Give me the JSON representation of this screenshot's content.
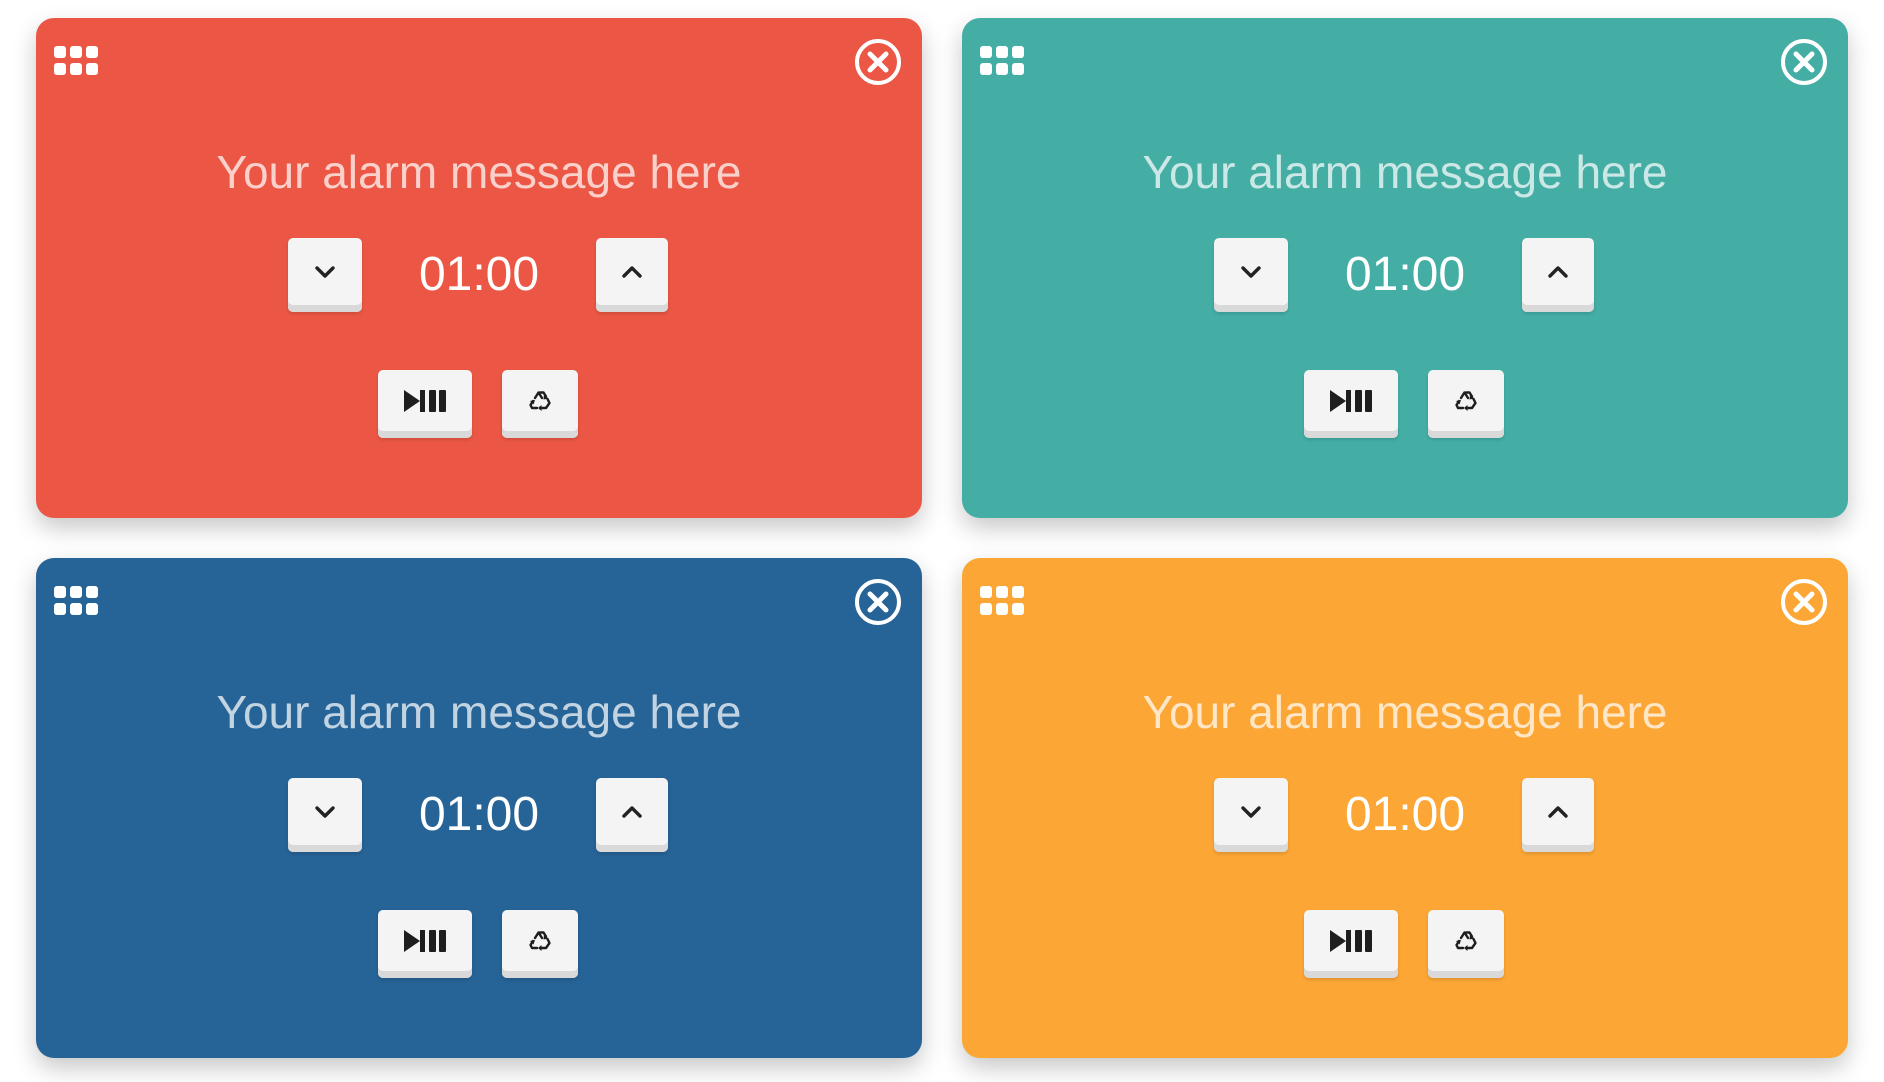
{
  "alarms": [
    {
      "message": "Your alarm message here",
      "time": "01:00",
      "color": "#eb5744"
    },
    {
      "message": "Your alarm message here",
      "time": "01:00",
      "color": "#44aea5"
    },
    {
      "message": "Your alarm message here",
      "time": "01:00",
      "color": "#266396"
    },
    {
      "message": "Your alarm message here",
      "time": "01:00",
      "color": "#fba635"
    }
  ],
  "icons": {
    "drag": "grid-dots-icon",
    "close": "close-circle-icon",
    "decrease": "chevron-down-icon",
    "increase": "chevron-up-icon",
    "play_pause": "play-pause-icon",
    "reset": "recycle-icon"
  },
  "theme": {
    "button_face": "#f4f4f4",
    "text_color": "#ffffff"
  }
}
